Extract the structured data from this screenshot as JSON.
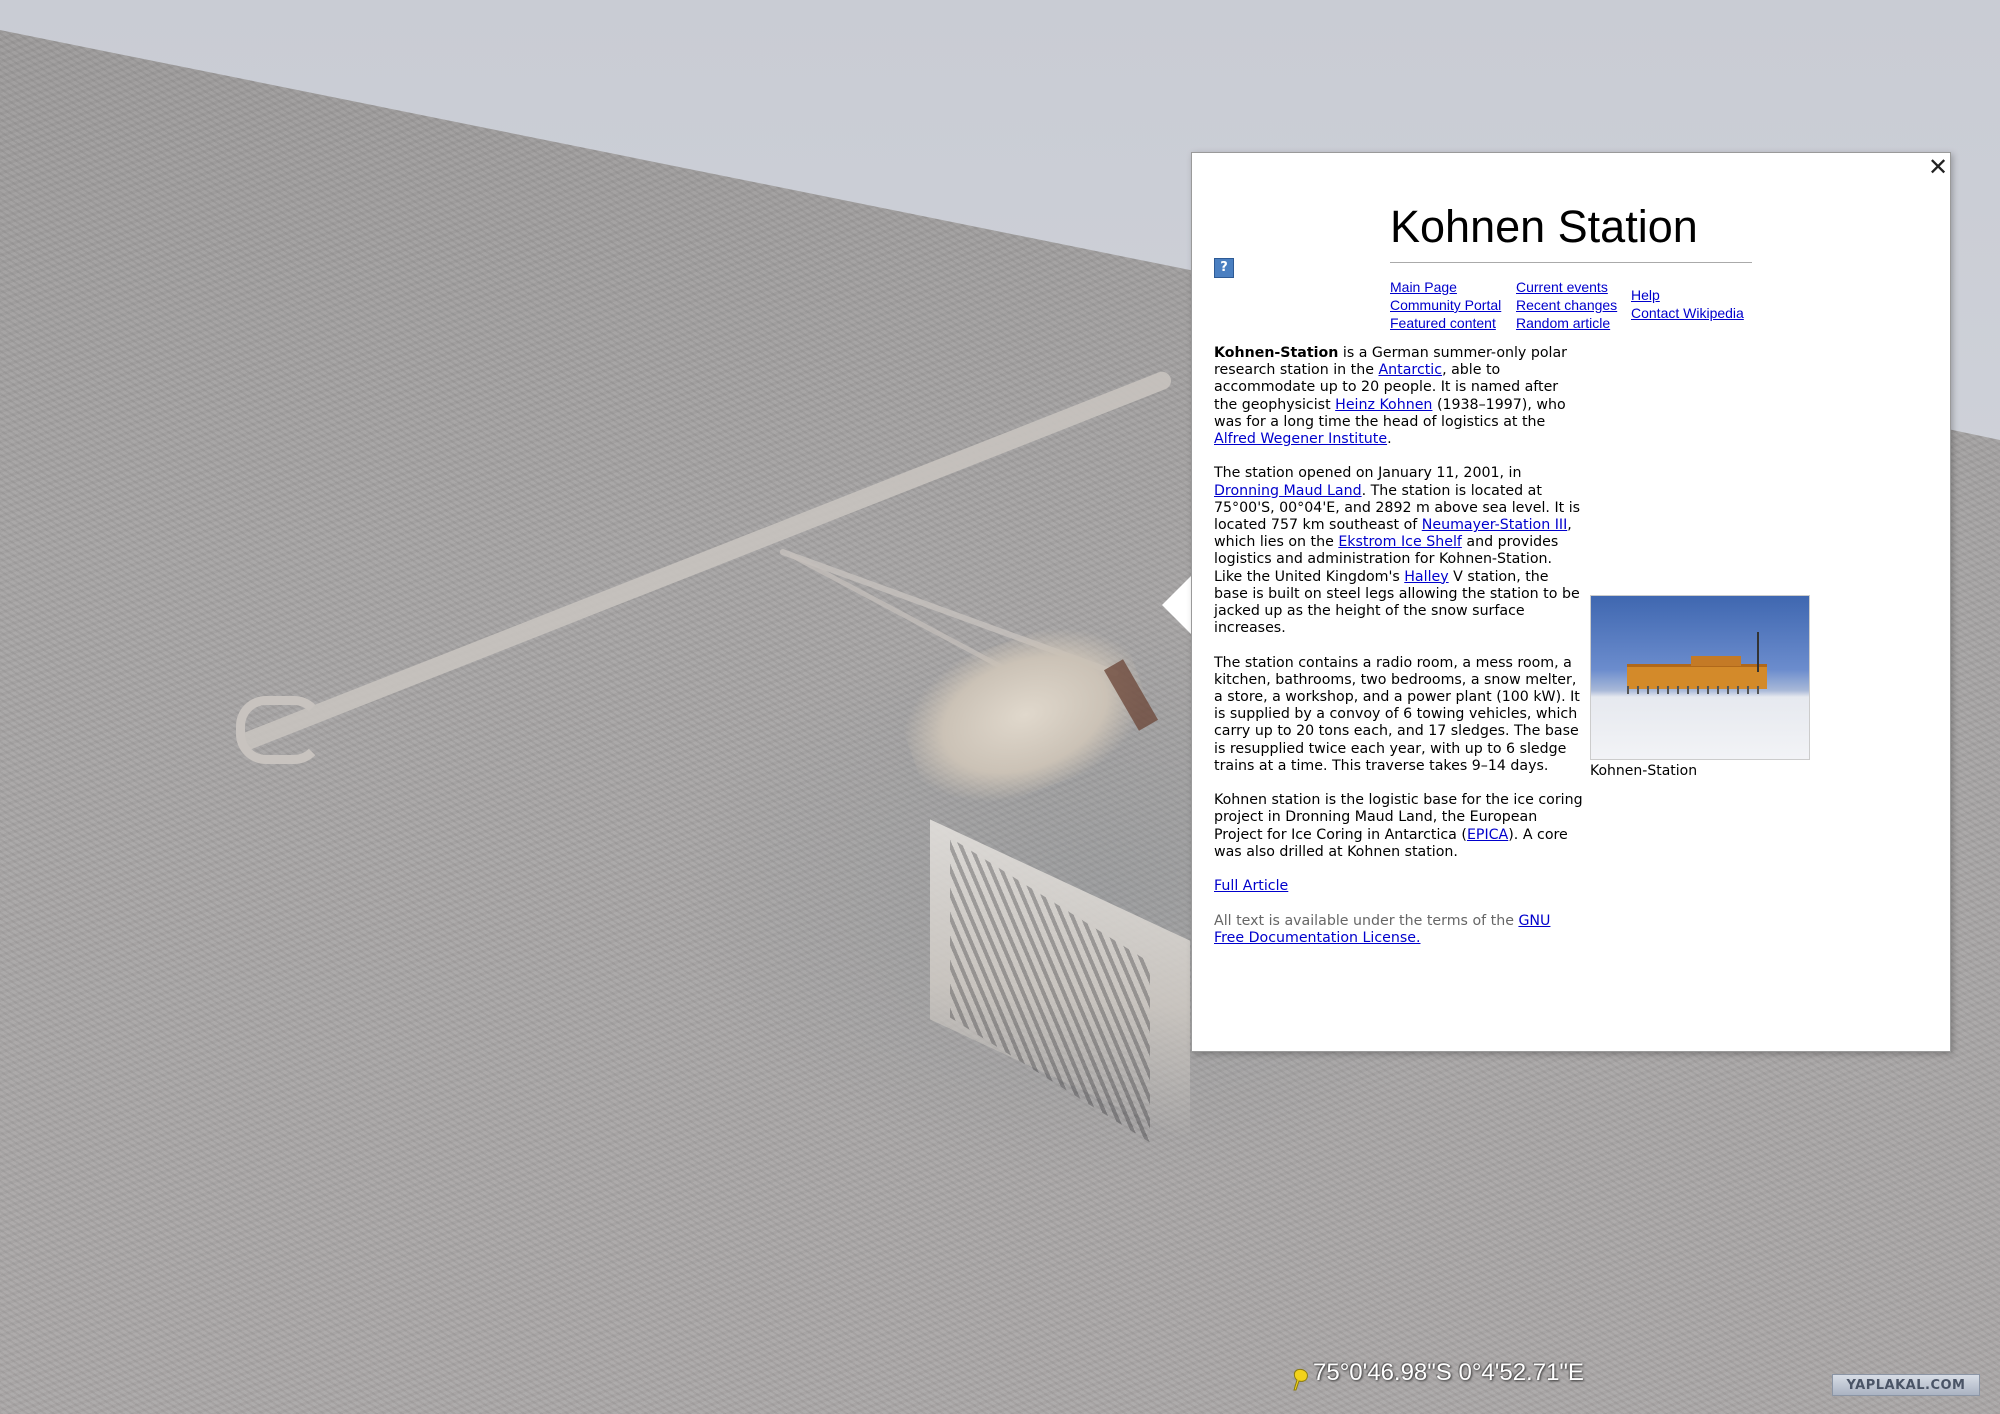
{
  "article": {
    "title": "Kohnen Station",
    "close_glyph": "✕",
    "help_glyph": "?",
    "nav": {
      "main_page": "Main Page",
      "community_portal": "Community Portal",
      "featured_content": "Featured content",
      "current_events": "Current events",
      "recent_changes": "Recent changes",
      "random_article": "Random article",
      "help": "Help",
      "contact": "Contact Wikipedia"
    },
    "p1": {
      "bold": "Kohnen-Station",
      "t1": " is a German summer-only polar research station in the ",
      "l1": "Antarctic",
      "t2": ", able to accommodate up to 20 people. It is named after the geophysicist ",
      "l2": "Heinz Kohnen",
      "t3": " (1938–1997), who was for a long time the head of logistics at the ",
      "l3": "Alfred Wegener Institute",
      "t4": "."
    },
    "p2": {
      "t1": "The station opened on January 11, 2001, in ",
      "l1": "Dronning Maud Land",
      "t2": ". The station is located at 75°00'S, 00°04'E, and 2892 m above sea level. It is located 757 km southeast of ",
      "l2": "Neumayer-Station III",
      "t3": ", which lies on the ",
      "l3": "Ekstrom Ice Shelf",
      "t4": " and provides logistics and administration for Kohnen-Station. Like the United Kingdom's ",
      "l4": "Halley",
      "t5": " V station, the base is built on steel legs allowing the station to be jacked up as the height of the snow surface increases."
    },
    "p3": "The station contains a radio room, a mess room, a kitchen, bathrooms, two bedrooms, a snow melter, a store, a workshop, and a power plant (100 kW). It is supplied by a convoy of 6 towing vehicles, which carry up to 20 tons each, and 17 sledges. The base is resupplied twice each year, with up to 6 sledge trains at a time. This traverse takes 9–14 days.",
    "p4": {
      "t1": "Kohnen station is the logistic base for the ice coring project in Dronning Maud Land, the European Project for Ice Coring in Antarctica (",
      "l1": "EPICA",
      "t2": "). A core was also drilled at Kohnen station."
    },
    "full_article": "Full Article",
    "license": {
      "t1": "All text is available under the terms of the ",
      "l1": "GNU Free Documentation License."
    },
    "image_caption": "Kohnen-Station"
  },
  "status": {
    "coordinates": "75°0'46.98\"S 0°4'52.71\"E"
  },
  "watermark": "YAPLAKAL.COM",
  "colors": {
    "link": "#0000cc",
    "placemark": "#f2d21a"
  }
}
